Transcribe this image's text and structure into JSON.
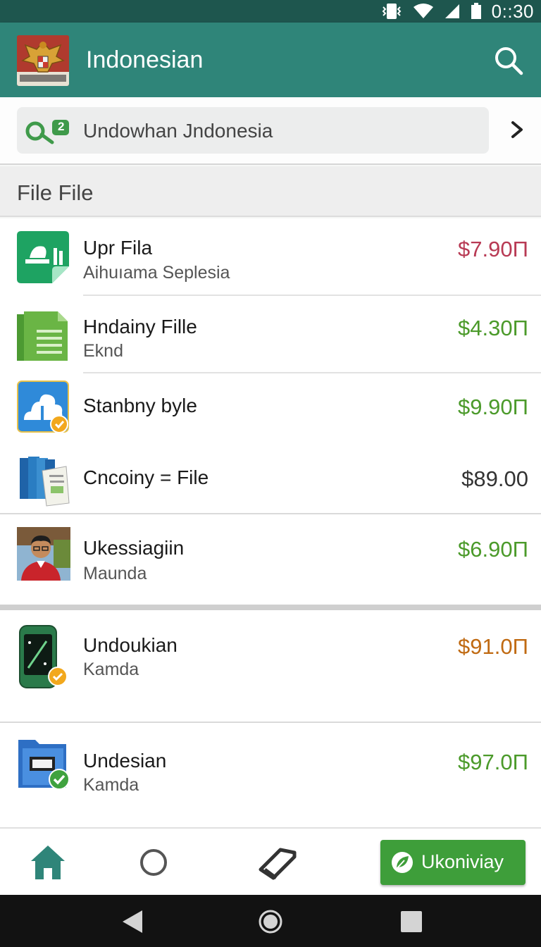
{
  "status_bar": {
    "time": "0::30"
  },
  "app_bar": {
    "title": "Indonesian",
    "search_icon": "search-icon",
    "logo_icon": "garuda-emblem-icon"
  },
  "banner": {
    "text": "Undowhan Jndonesia",
    "badge": "2",
    "icon": "key-icon",
    "chevron_icon": "chevron-right-icon"
  },
  "section": {
    "title": "File File"
  },
  "items": [
    {
      "title": "Upr Fila",
      "subtitle": "Aihuıama Seplesia",
      "price": "$7.90Π",
      "price_color": "#b83a54",
      "icon": "sheet-app-icon"
    },
    {
      "title": "Hndainy Fille",
      "subtitle": "Eknd",
      "price": "$4.30Π",
      "price_color": "#4b9a2a",
      "icon": "green-document-icon"
    },
    {
      "title": "Stanbny byle",
      "subtitle": "",
      "price": "$9.90Π",
      "price_color": "#4b9a2a",
      "icon": "cloud-app-icon"
    },
    {
      "title": "Cncoiny = File",
      "subtitle": "",
      "price": "$89.00",
      "price_color": "#333333",
      "icon": "books-icon"
    },
    {
      "title": "Ukessiagiin",
      "subtitle": "Maunda",
      "price": "$6.90Π",
      "price_color": "#4b9a2a",
      "icon": "person-photo"
    },
    {
      "title": "Undoukian",
      "subtitle": "Kamda",
      "price": "$91.0Π",
      "price_color": "#c06a12",
      "icon": "phone-app-icon"
    },
    {
      "title": "Undesian",
      "subtitle": "Kamda",
      "price": "$97.0Π",
      "price_color": "#4b9a2a",
      "icon": "blue-folder-icon"
    }
  ],
  "bottom_nav": {
    "home_icon": "home-icon",
    "circle_icon": "circle-icon",
    "tag_icon": "tag-icon",
    "cta_label": "Ukoniviay",
    "cta_icon": "leaf-check-icon"
  },
  "system_nav": {
    "back": "back-icon",
    "home": "system-home-icon",
    "recents": "recents-icon"
  }
}
